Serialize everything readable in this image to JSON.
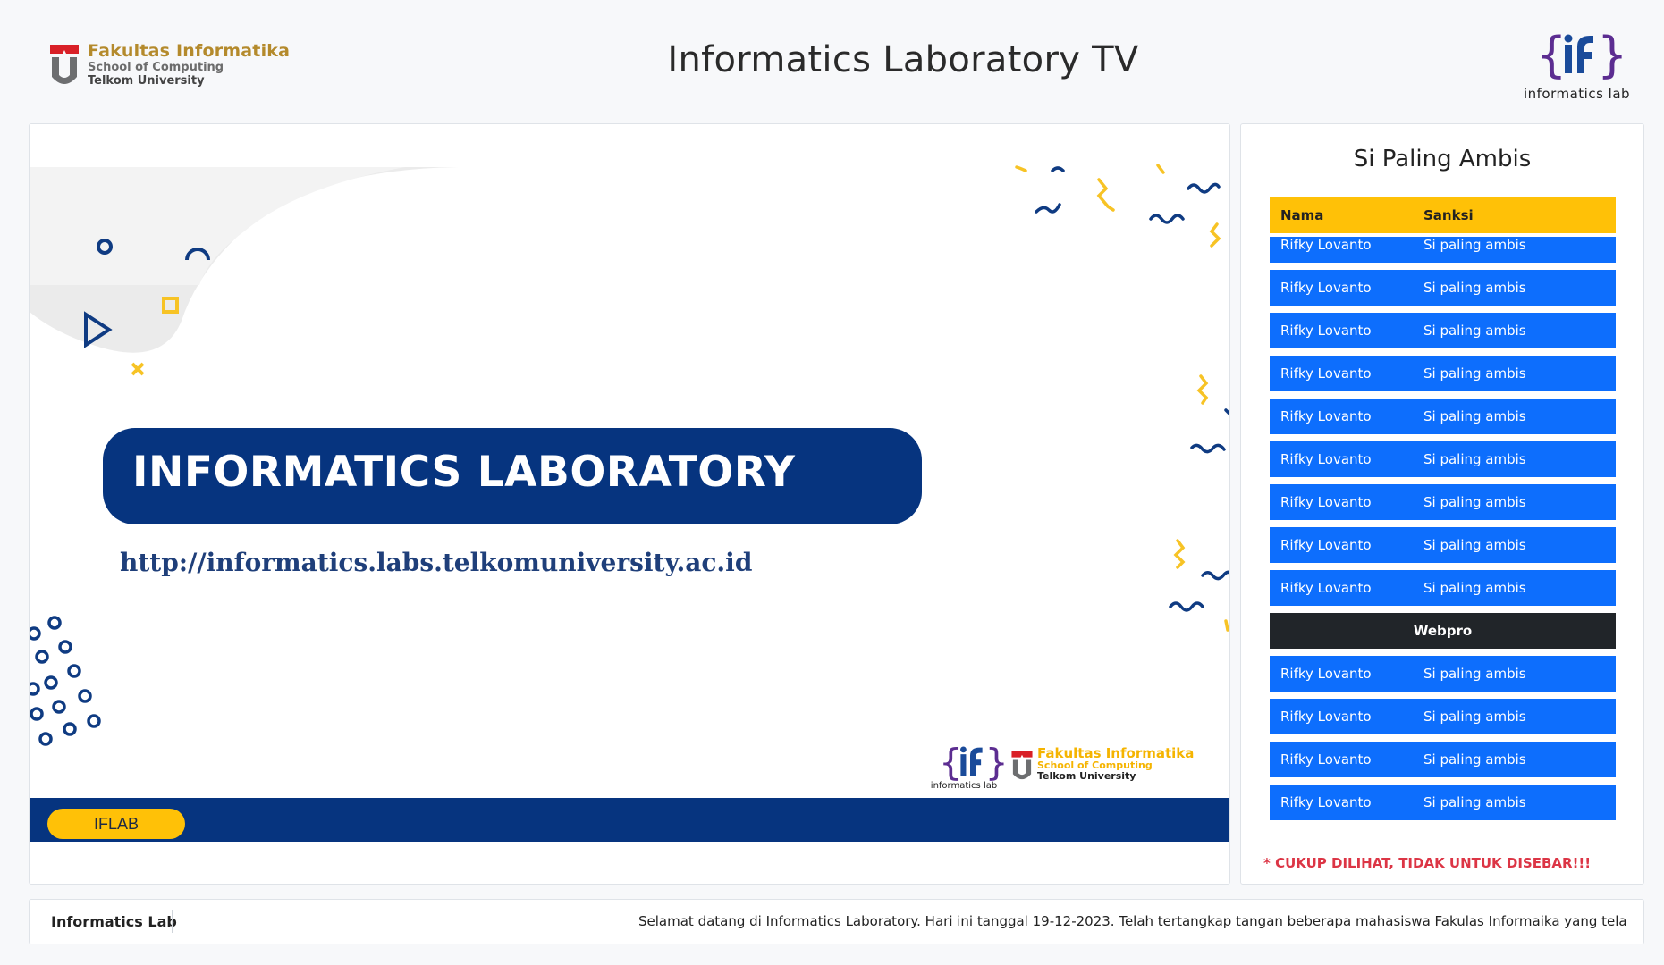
{
  "header": {
    "left_logo": {
      "title": "Fakultas Informatika",
      "line2": "School of Computing",
      "line3": "Telkom University"
    },
    "title": "Informatics Laboratory TV",
    "right_logo": {
      "caption": "informatics lab"
    }
  },
  "slide": {
    "banner": "INFORMATICS LABORATORY",
    "url": "http://informatics.labs.telkomuniversity.ac.id",
    "logos": {
      "if_caption": "informatics lab",
      "fi_title": "Fakultas Informatika",
      "fi_line2": "School of Computing",
      "fi_line3": "Telkom University"
    },
    "pill": "IFLAB"
  },
  "leaderboard": {
    "title": "Si Paling Ambis",
    "columns": [
      "Nama",
      "Sanksi"
    ],
    "rows": [
      {
        "type": "row",
        "nama": "Rifky Lovanto",
        "sanksi": "Si paling ambis"
      },
      {
        "type": "row",
        "nama": "Rifky Lovanto",
        "sanksi": "Si paling ambis"
      },
      {
        "type": "row",
        "nama": "Rifky Lovanto",
        "sanksi": "Si paling ambis"
      },
      {
        "type": "row",
        "nama": "Rifky Lovanto",
        "sanksi": "Si paling ambis"
      },
      {
        "type": "row",
        "nama": "Rifky Lovanto",
        "sanksi": "Si paling ambis"
      },
      {
        "type": "row",
        "nama": "Rifky Lovanto",
        "sanksi": "Si paling ambis"
      },
      {
        "type": "row",
        "nama": "Rifky Lovanto",
        "sanksi": "Si paling ambis"
      },
      {
        "type": "row",
        "nama": "Rifky Lovanto",
        "sanksi": "Si paling ambis"
      },
      {
        "type": "row",
        "nama": "Rifky Lovanto",
        "sanksi": "Si paling ambis"
      },
      {
        "type": "group",
        "label": "Webpro"
      },
      {
        "type": "row",
        "nama": "Rifky Lovanto",
        "sanksi": "Si paling ambis"
      },
      {
        "type": "row",
        "nama": "Rifky Lovanto",
        "sanksi": "Si paling ambis"
      },
      {
        "type": "row",
        "nama": "Rifky Lovanto",
        "sanksi": "Si paling ambis"
      },
      {
        "type": "row",
        "nama": "Rifky Lovanto",
        "sanksi": "Si paling ambis"
      }
    ],
    "warning": "* CUKUP DILIHAT, TIDAK UNTUK DISEBAR!!!"
  },
  "footer": {
    "brand": "Informatics Lab",
    "ticker": "Selamat datang di Informatics Laboratory. Hari ini tanggal 19-12-2023. Telah tertangkap tangan beberapa mahasiswa Fakulas Informaika yang telah melakukan"
  },
  "colors": {
    "navy": "#06347f",
    "yellow": "#ffc107",
    "blue_row": "#0d6efd",
    "group_row": "#212529",
    "warning": "#dc3545",
    "gold_logo": "#b48a2c"
  }
}
